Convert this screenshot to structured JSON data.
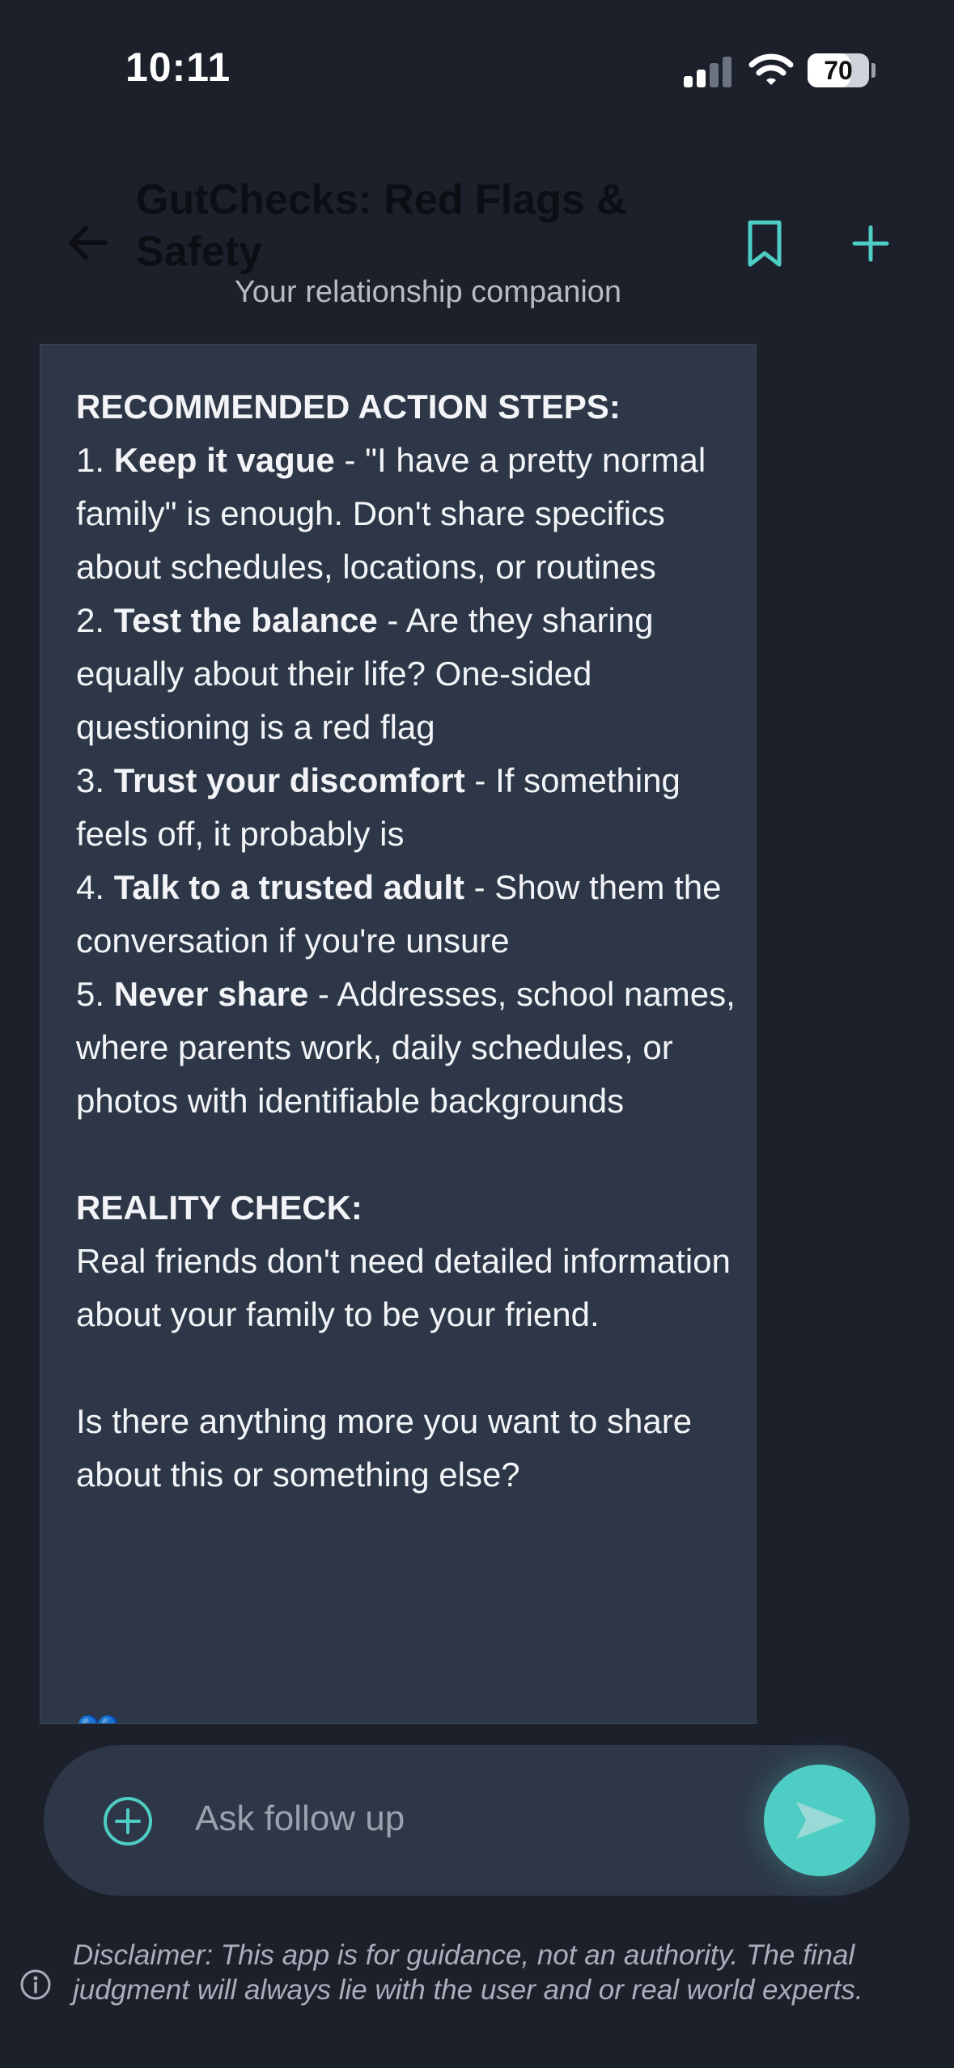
{
  "status_bar": {
    "time": "10:11",
    "battery_level": "70",
    "battery_fraction": 0.7,
    "signal_bars_active": 2,
    "signal_bars_total": 4
  },
  "header": {
    "title": "GutChecks: Red Flags & Safety",
    "subtitle": "Your relationship companion",
    "back_icon": "arrow-left-icon",
    "bookmark_icon": "bookmark-icon",
    "new_icon": "plus-icon"
  },
  "message": {
    "action_heading": "RECOMMENDED ACTION STEPS:",
    "steps": [
      {
        "num": "1.",
        "title": "Keep it vague",
        "text": " - \"I have a pretty normal family\" is enough. Don't share specifics about schedules, locations, or routines"
      },
      {
        "num": "2.",
        "title": "Test the balance",
        "text": " - Are they sharing equally about their life? One-sided questioning is a red flag"
      },
      {
        "num": "3.",
        "title": "Trust your discomfort",
        "text": " - If something feels off, it probably is"
      },
      {
        "num": "4.",
        "title": "Talk to a trusted adult",
        "text": " - Show them the conversation if you're unsure"
      },
      {
        "num": "5.",
        "title": "Never share",
        "text": " - Addresses, school names, where parents work, daily schedules, or photos with identifiable backgrounds"
      }
    ],
    "reality_heading": "REALITY CHECK:",
    "reality_text": "Real friends don't need detailed information about your family to be your friend.",
    "closing": "Is there anything more you want to share about this or something else?",
    "trailing_emoji": "💙"
  },
  "input": {
    "placeholder": "Ask follow up",
    "attach_icon": "plus-circle-icon",
    "send_icon": "send-icon"
  },
  "disclaimer": {
    "text": "Disclaimer: This app is for guidance, not an authority. The final judgment will always lie with the user and or real world experts.",
    "icon": "info-icon"
  },
  "colors": {
    "background": "#1c202b",
    "bubble": "#2e3747",
    "accent": "#4ecdc4",
    "muted_text": "#b6bcc6"
  }
}
